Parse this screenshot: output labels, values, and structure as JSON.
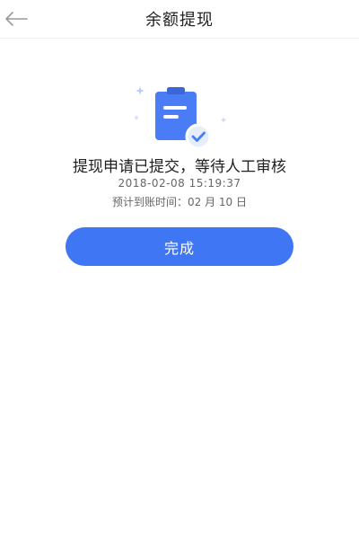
{
  "header": {
    "title": "余额提现",
    "back_icon": "arrow-left-icon"
  },
  "status": {
    "icon": "clipboard-check-icon",
    "title": "提现申请已提交，等待人工审核",
    "datetime": "2018-02-08  15:19:37",
    "arrival": "预计到账时间：02 月 10 日"
  },
  "actions": {
    "done_label": "完成"
  },
  "colors": {
    "accent": "#3f76f3",
    "icon_blue": "#4a7cf6",
    "badge_bg": "#e6eefb"
  }
}
